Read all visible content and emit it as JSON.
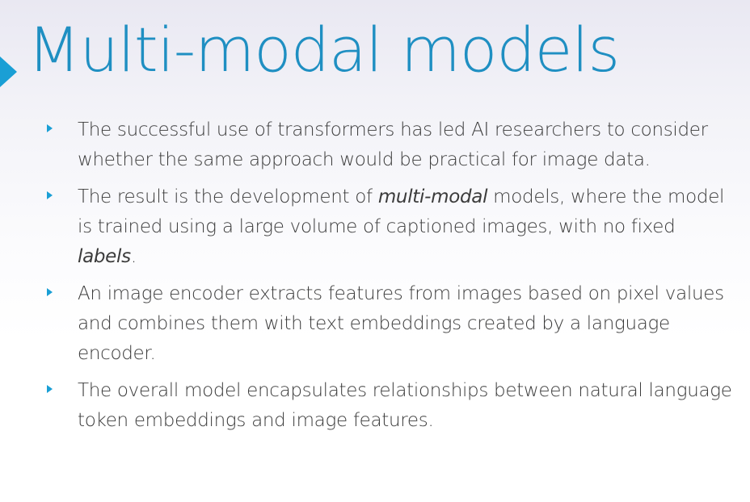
{
  "slide": {
    "title": "Multi-modal models"
  },
  "bullets": [
    {
      "text": "The successful use of transformers has led AI researchers to consider whether the same approach would be practical for image data."
    },
    {
      "part1": "The result is the development of ",
      "em1": "multi-modal",
      "part2": " models, where the model is trained using a large volume of captioned images, with no fixed ",
      "em2": "labels",
      "part3": "."
    },
    {
      "text": "An image encoder extracts features from images based on pixel values and combines them with text embeddings created by a language encoder."
    },
    {
      "text": "The overall model encapsulates relationships between natural language token embeddings and image features."
    }
  ],
  "colors": {
    "accent": "#1a9fd5",
    "title": "#1f8fc2",
    "body_text": "#3b3b3b"
  }
}
